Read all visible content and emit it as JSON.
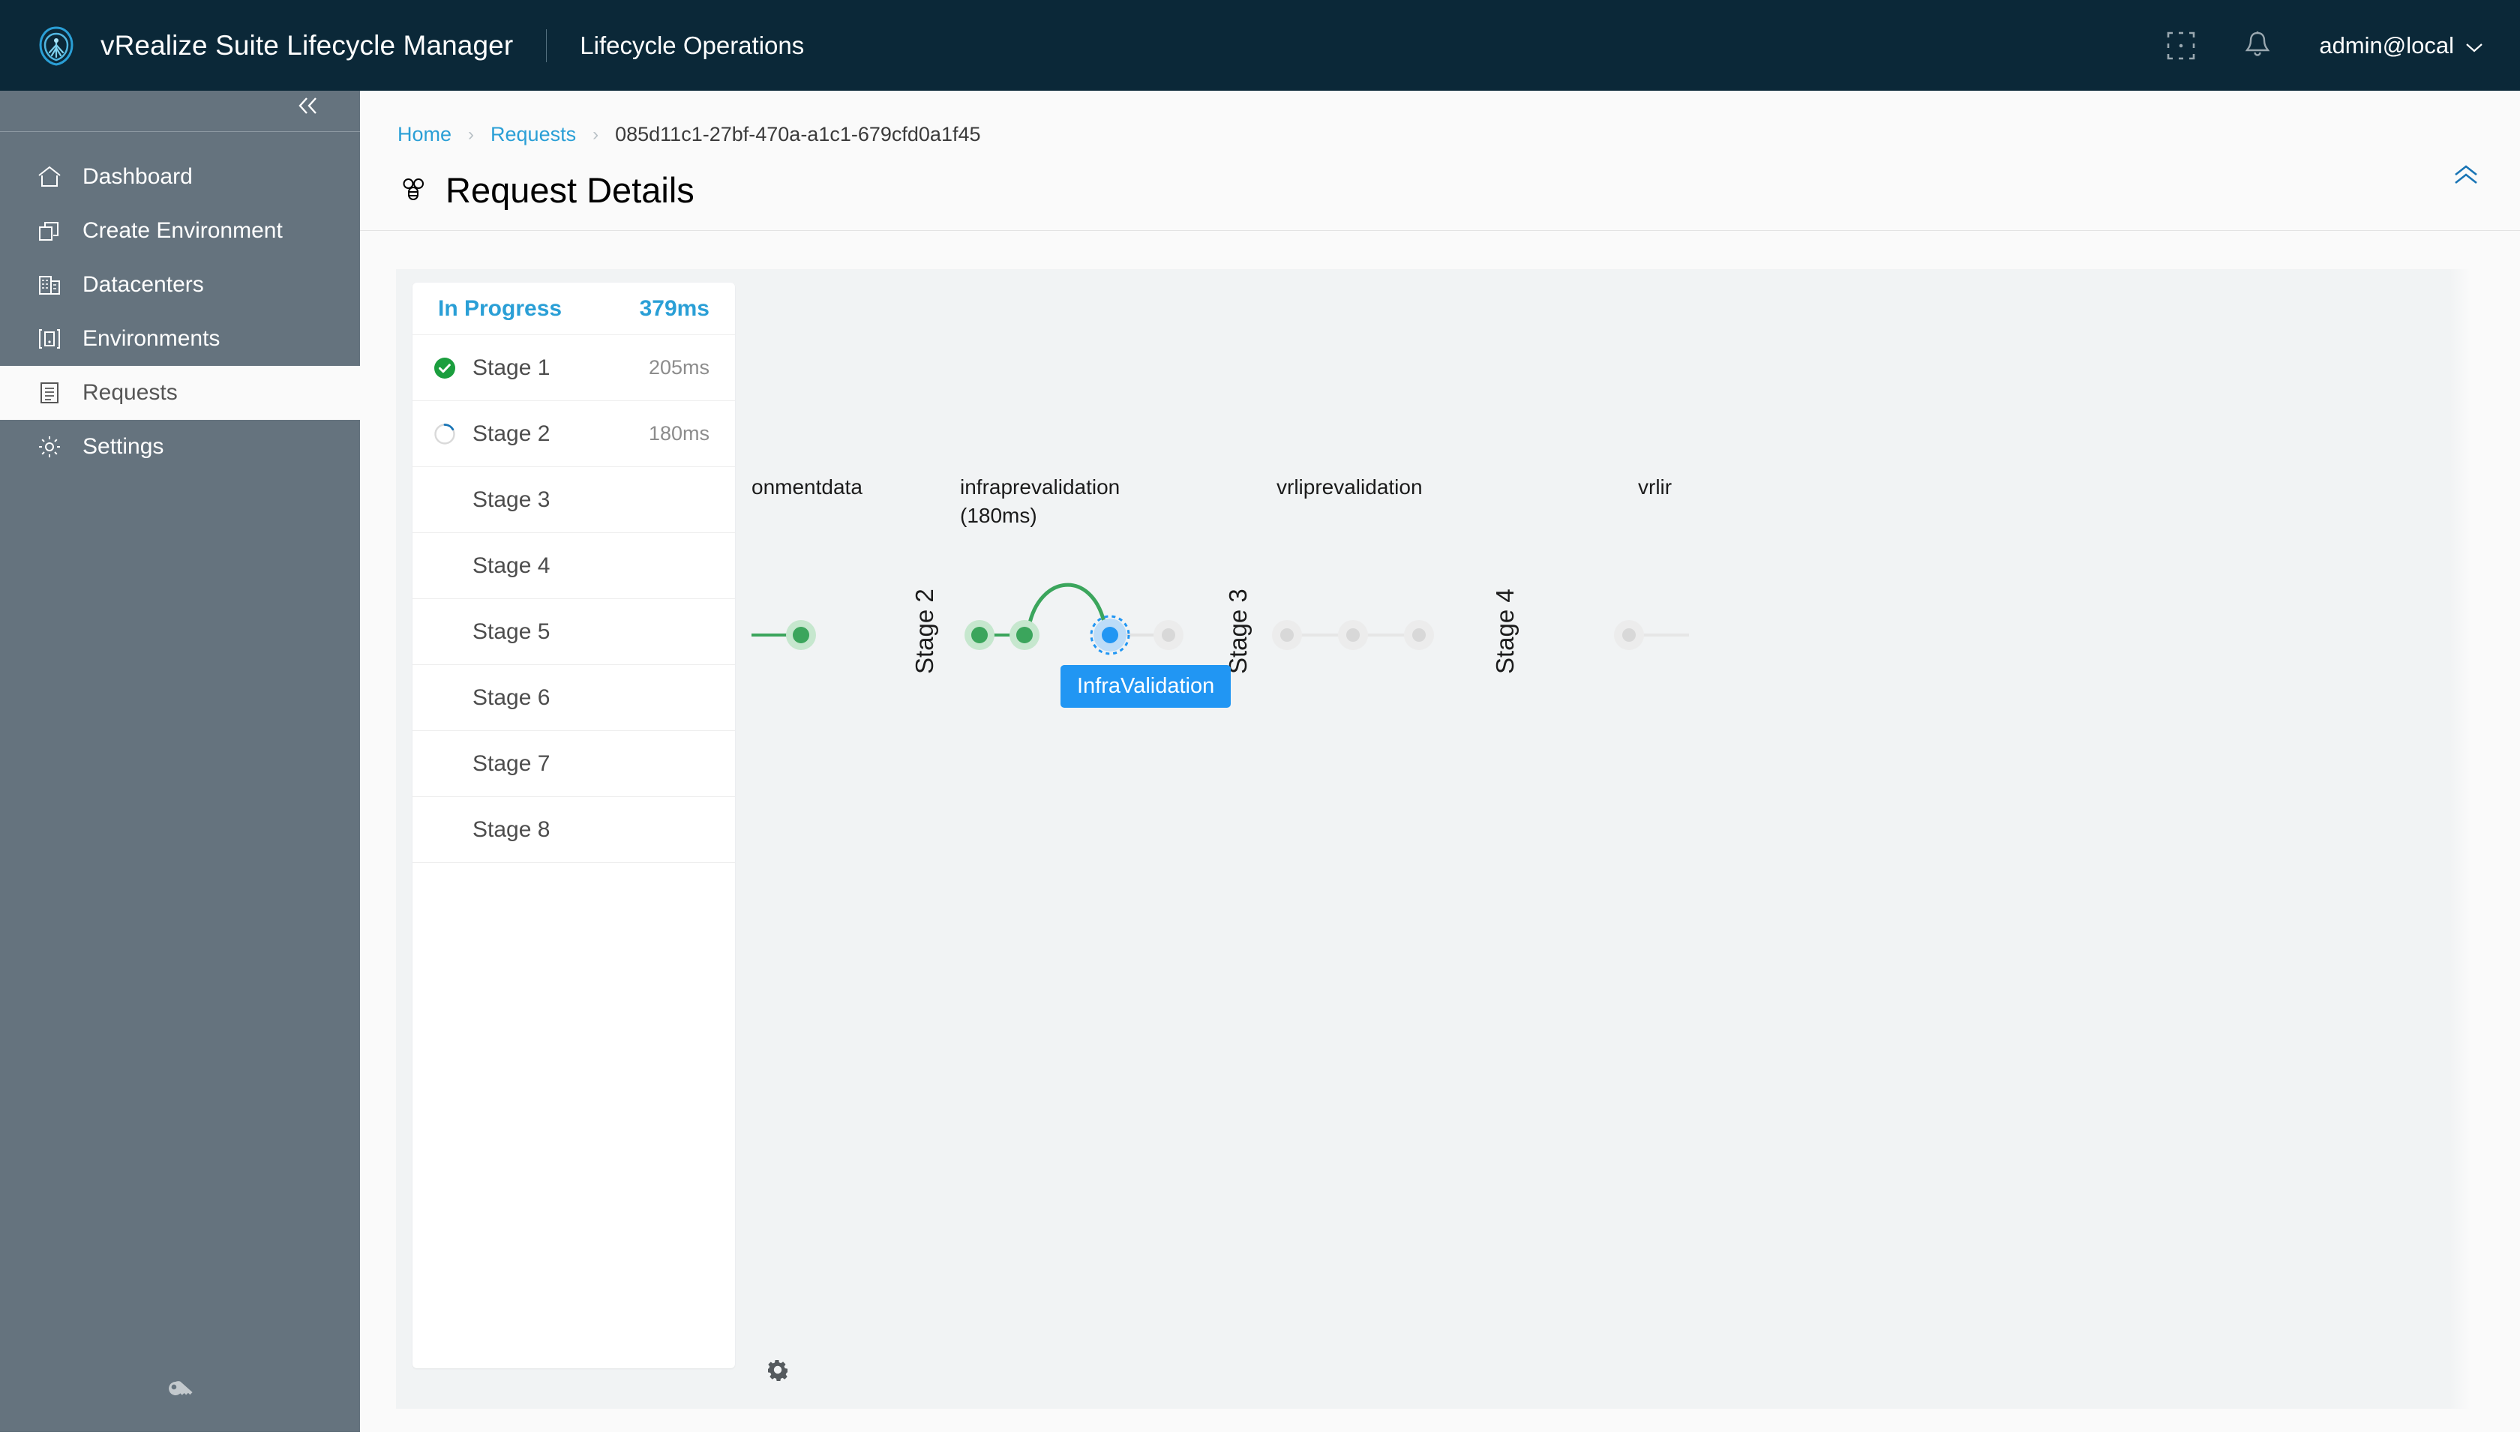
{
  "header": {
    "logo_icon": "vmware-cloud-logo-icon",
    "product_title": "vRealize Suite Lifecycle Manager",
    "section_title": "Lifecycle Operations",
    "apps_icon": "grid-apps-icon",
    "notifications_icon": "bell-icon",
    "user": "admin@local",
    "user_chevron_icon": "chevron-down-icon"
  },
  "sidebar": {
    "collapse_icon": "double-chevron-left-icon",
    "footer_icon": "key-icon",
    "items": [
      {
        "label": "Dashboard",
        "icon": "home-icon",
        "active": false
      },
      {
        "label": "Create Environment",
        "icon": "copy-icon",
        "active": false
      },
      {
        "label": "Datacenters",
        "icon": "building-icon",
        "active": false
      },
      {
        "label": "Environments",
        "icon": "application-icon",
        "active": false
      },
      {
        "label": "Requests",
        "icon": "list-icon",
        "active": true
      },
      {
        "label": "Settings",
        "icon": "gear-icon",
        "active": false
      }
    ]
  },
  "breadcrumb": {
    "home": "Home",
    "requests": "Requests",
    "separator": "›",
    "current": "085d11c1-27bf-470a-a1c1-679cfd0a1f45"
  },
  "page": {
    "title": "Request Details",
    "title_icon": "request-details-icon",
    "collapse_icon": "double-chevron-up-icon"
  },
  "request": {
    "status_label": "In Progress",
    "total_duration": "379ms",
    "stages": [
      {
        "name": "Stage 1",
        "duration": "205ms",
        "state": "complete"
      },
      {
        "name": "Stage 2",
        "duration": "180ms",
        "state": "in-progress"
      },
      {
        "name": "Stage 3",
        "duration": "",
        "state": "pending"
      },
      {
        "name": "Stage 4",
        "duration": "",
        "state": "pending"
      },
      {
        "name": "Stage 5",
        "duration": "",
        "state": "pending"
      },
      {
        "name": "Stage 6",
        "duration": "",
        "state": "pending"
      },
      {
        "name": "Stage 7",
        "duration": "",
        "state": "pending"
      },
      {
        "name": "Stage 8",
        "duration": "",
        "state": "pending"
      }
    ]
  },
  "graph": {
    "settings_icon": "gear-icon",
    "selected_tooltip": "InfraValidation",
    "stage_labels": [
      {
        "text": "Stage 2"
      },
      {
        "text": "Stage 3"
      },
      {
        "text": "Stage 4"
      }
    ],
    "node_groups": [
      {
        "title": "onmentdata",
        "subtitle": ""
      },
      {
        "title": "infraprevalidation",
        "subtitle": "(180ms)"
      },
      {
        "title": "vrliprevalidation",
        "subtitle": ""
      },
      {
        "title": "vrlir",
        "subtitle": ""
      }
    ]
  },
  "colors": {
    "brand_dark": "#0b2838",
    "sidebar": "#65737e",
    "accent_blue": "#2a9fd6",
    "node_blue": "#2196f3",
    "success_green": "#3ba55c",
    "pending_grey": "#d8d8d8"
  }
}
